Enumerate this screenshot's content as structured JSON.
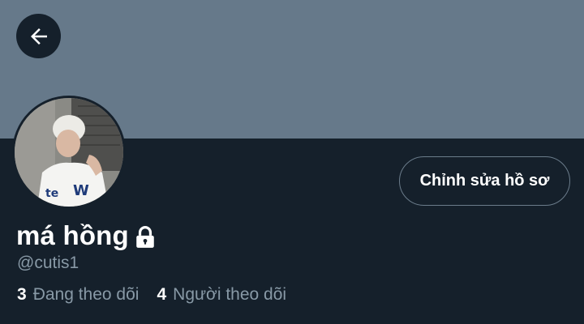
{
  "header": {
    "back_icon": "arrow-left-icon",
    "banner_color": "#66798a"
  },
  "profile": {
    "display_name": "má hồng",
    "lock_icon": "lock-icon",
    "handle": "@cutis1",
    "edit_button_label": "Chỉnh sửa hồ sơ",
    "following_count": "3",
    "following_label": "Đang theo dõi",
    "followers_count": "4",
    "followers_label": "Người theo dõi"
  },
  "colors": {
    "background": "#15202b",
    "secondary_text": "#8899a6",
    "button_border": "#6b7c8b"
  }
}
